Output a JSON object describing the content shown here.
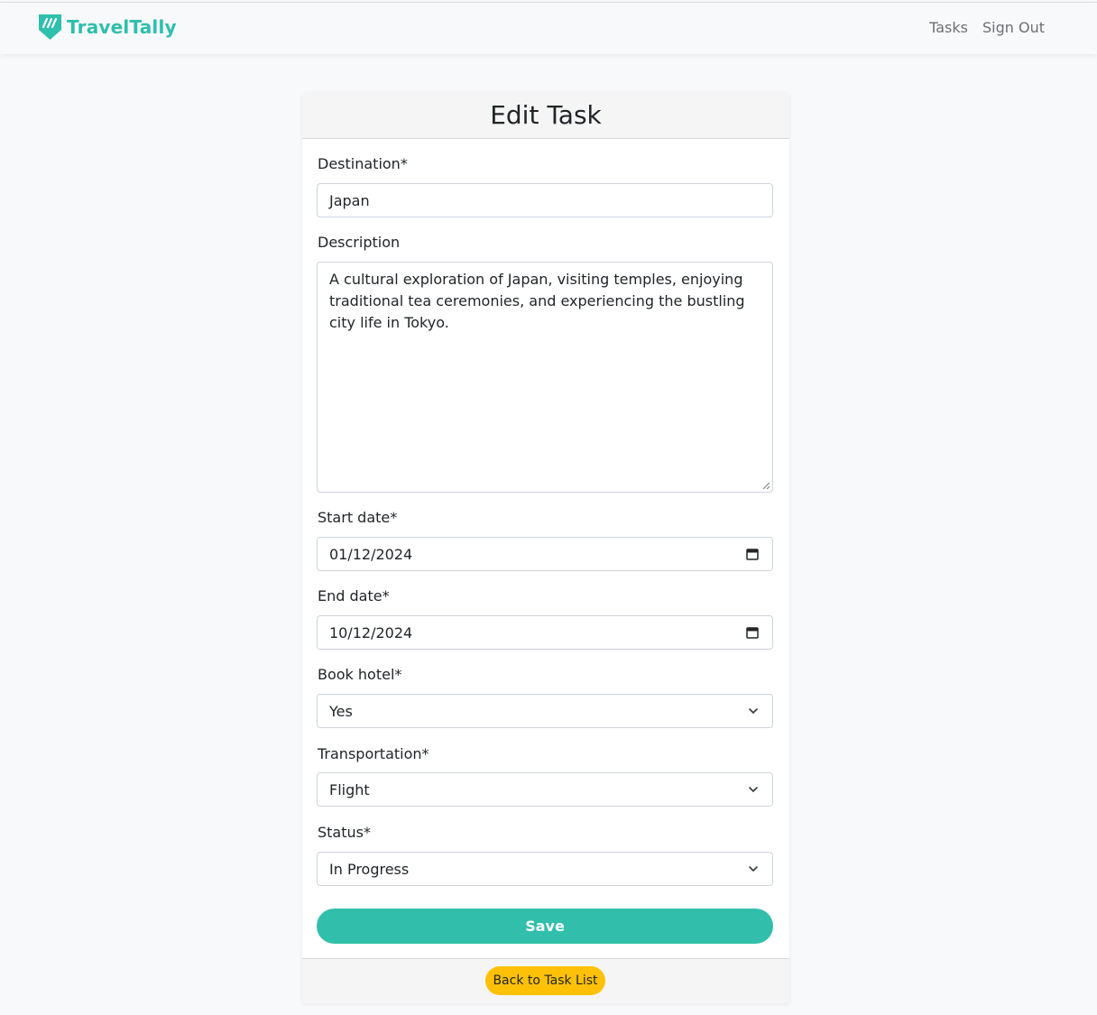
{
  "app": {
    "brand_name": "TravelTally",
    "brand_color": "#2ebfad",
    "brand_icon": "brand-shield-icon"
  },
  "nav": {
    "links": [
      {
        "label": "Tasks"
      },
      {
        "label": "Sign Out"
      }
    ]
  },
  "form": {
    "title": "Edit Task",
    "fields": {
      "destination": {
        "label": "Destination*",
        "value": "Japan"
      },
      "description": {
        "label": "Description",
        "value": "A cultural exploration of Japan, visiting temples, enjoying traditional tea ceremonies, and experiencing the bustling city life in Tokyo."
      },
      "start_date": {
        "label": "Start date*",
        "value": "01/12/2024",
        "icon": "calendar-icon"
      },
      "end_date": {
        "label": "End date*",
        "value": "10/12/2024",
        "icon": "calendar-icon"
      },
      "book_hotel": {
        "label": "Book hotel*",
        "value": "Yes",
        "icon": "chevron-down-icon"
      },
      "transportation": {
        "label": "Transportation*",
        "value": "Flight",
        "icon": "chevron-down-icon"
      },
      "status": {
        "label": "Status*",
        "value": "In Progress",
        "icon": "chevron-down-icon"
      }
    },
    "save_label": "Save",
    "back_label": "Back to Task List"
  },
  "colors": {
    "primary": "#31bfab",
    "warning": "#ffc107",
    "background": "#f8f9fa"
  }
}
